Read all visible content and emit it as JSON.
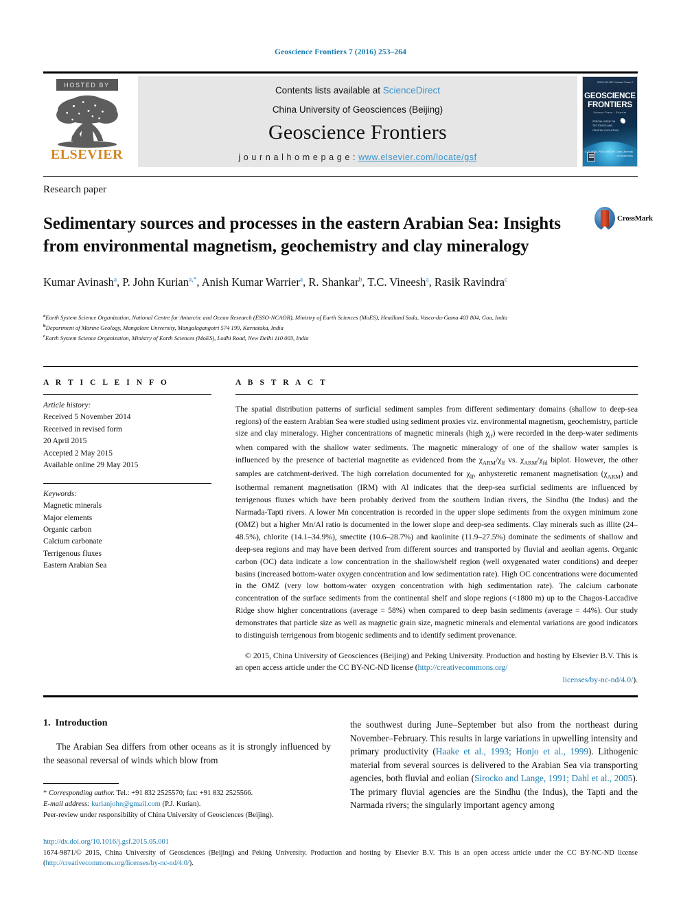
{
  "running_head": "Geoscience Frontiers 7 (2016) 253–264",
  "masthead": {
    "hosted_by": "HOSTED BY",
    "publisher_logo_word": "ELSEVIER",
    "contents_prefix": "Contents lists available at ",
    "contents_link": "ScienceDirect",
    "society_line": "China University of Geosciences (Beijing)",
    "journal_title": "Geoscience Frontiers",
    "homepage_label": "j o u r n a l   h o m e p a g e :  ",
    "homepage_url": "www.elsevier.com/locate/gsf",
    "cover": {
      "kicker": "ISSN 1674-9871\nVolume 7  Issue 2",
      "title_line1": "GEOSCIENCE",
      "title_line2": "FRONTIERS",
      "subtitle": "Science Press  ·  Elsevier",
      "mid_line1": "SPECIAL ISSUE ON",
      "mid_line2": "TECTONICS AND",
      "mid_line3": "CRUSTAL EVOLUTION",
      "bottom": "A JOURNAL PUBLISHED BY\nChina University of Geosciences"
    }
  },
  "article": {
    "kicker": "Research paper",
    "title": "Sedimentary sources and processes in the eastern Arabian Sea: Insights from environmental magnetism, geochemistry and clay mineralogy",
    "crossmark_label": "CrossMark",
    "authors": [
      {
        "name": "Kumar Avinash",
        "marks": "a"
      },
      {
        "name": "P. John Kurian",
        "marks": "a,*"
      },
      {
        "name": "Anish Kumar Warrier",
        "marks": "a"
      },
      {
        "name": "R. Shankar",
        "marks": "b"
      },
      {
        "name": "T.C. Vineesh",
        "marks": "a"
      },
      {
        "name": "Rasik Ravindra",
        "marks": "c"
      }
    ],
    "affiliations": [
      {
        "mark": "a",
        "text": "Earth System Science Organization, National Centre for Antarctic and Ocean Research (ESSO-NCAOR), Ministry of Earth Sciences (MoES), Headland Sada, Vasco-da-Gama 403 804, Goa, India"
      },
      {
        "mark": "b",
        "text": "Department of Marine Geology, Mangalore University, Mangalagangotri 574 199, Karnataka, India"
      },
      {
        "mark": "c",
        "text": "Earth System Science Organization, Ministry of Earth Sciences (MoES), Lodhi Road, New Delhi 110 003, India"
      }
    ]
  },
  "article_info": {
    "heading": "A R T I C L E  I N F O",
    "history_label": "Article history:",
    "history": [
      "Received 5 November 2014",
      "Received in revised form",
      "20 April 2015",
      "Accepted 2 May 2015",
      "Available online 29 May 2015"
    ],
    "keywords_label": "Keywords:",
    "keywords": [
      "Magnetic minerals",
      "Major elements",
      "Organic carbon",
      "Calcium carbonate",
      "Terrigenous fluxes",
      "Eastern Arabian Sea"
    ]
  },
  "abstract": {
    "heading": "A B S T R A C T",
    "body_part1": "The spatial distribution patterns of surficial sediment samples from different sedimentary domains (shallow to deep-sea regions) of the eastern Arabian Sea were studied using sediment proxies viz. environmental magnetism, geochemistry, particle size and clay mineralogy. Higher concentrations of magnetic minerals (high ",
    "chi_lf_1": "χ",
    "chi_lf_1_sub": "lf",
    "body_part2": ") were recorded in the deep-water sediments when compared with the shallow water sediments. The magnetic mineralogy of one of the shallow water samples is influenced by the presence of bacterial magnetite as evidenced from the ",
    "biplot_x1": "χ",
    "biplot_x1_sub": "ARM",
    "biplot_sep1": "/",
    "biplot_x2": "χ",
    "biplot_x2_sub": "lf",
    "biplot_vs": " vs. ",
    "biplot_x3": "χ",
    "biplot_x3_sub": "ARM",
    "biplot_sep2": "/",
    "biplot_x4": "χ",
    "biplot_x4_sub": "fd",
    "body_part3": " biplot. However, the other samples are catchment-derived. The high correlation documented for ",
    "chi_lf_2": "χ",
    "chi_lf_2_sub": "lf",
    "body_part4": ", anhysteretic remanent magnetisation (",
    "chi_arm": "χ",
    "chi_arm_sub": "ARM",
    "body_part5": ") and isothermal remanent magnetisation (IRM) with Al indicates that the deep-sea surficial sediments are influenced by terrigenous fluxes which have been probably derived from the southern Indian rivers, the Sindhu (the Indus) and the Narmada-Tapti rivers. A lower Mn concentration is recorded in the upper slope sediments from the oxygen minimum zone (OMZ) but a higher Mn/Al ratio is documented in the lower slope and deep-sea sediments. Clay minerals such as illite (24–48.5%), chlorite (14.1–34.9%), smectite (10.6–28.7%) and kaolinite (11.9–27.5%) dominate the sediments of shallow and deep-sea regions and may have been derived from different sources and transported by fluvial and aeolian agents. Organic carbon (OC) data indicate a low concentration in the shallow/shelf region (well oxygenated water conditions) and deeper basins (increased bottom-water oxygen concentration and low sedimentation rate). High OC concentrations were documented in the OMZ (very low bottom-water oxygen concentration with high sedimentation rate). The calcium carbonate concentration of the surface sediments from the continental shelf and slope regions (<1800 m) up to the Chagos-Laccadive Ridge show higher concentrations (average = 58%) when compared to deep basin sediments (average = 44%). Our study demonstrates that particle size as well as magnetic grain size, magnetic minerals and elemental variations are good indicators to distinguish terrigenous from biogenic sediments and to identify sediment provenance.",
    "copyright_text": "© 2015, China University of Geosciences (Beijing) and Peking University. Production and hosting by Elsevier B.V. This is an open access article under the CC BY-NC-ND license (",
    "copyright_link_1": "http://creativecommons.org/",
    "copyright_link_2": "licenses/by-nc-nd/4.0/",
    "copyright_tail": ")."
  },
  "introduction": {
    "heading_number": "1.",
    "heading_text": "Introduction",
    "paragraph_left": "The Arabian Sea differs from other oceans as it is strongly influenced by the seasonal reversal of winds which blow from",
    "paragraph_right_a": "the southwest during June–September but also from the northeast during November–February. This results in large variations in upwelling intensity and primary productivity (",
    "cite_1": "Haake et al., 1993; Honjo et al., 1999",
    "paragraph_right_b": "). Lithogenic material from several sources is delivered to the Arabian Sea via transporting agencies, both fluvial and eolian (",
    "cite_2": "Sirocko and Lange, 1991; Dahl et al., 2005",
    "paragraph_right_c": "). The primary fluvial agencies are the Sindhu (the Indus), the Tapti and the Narmada rivers; the singularly important agency among"
  },
  "footnotes": {
    "corresponding_mark": "*",
    "corresponding_label": "Corresponding author.",
    "corresponding_text": " Tel.: +91 832 2525570; fax: +91 832 2525566.",
    "email_label": "E-mail address:",
    "email": "kurianjohn@gmail.com",
    "email_owner": " (P.J. Kurian).",
    "peer_review": "Peer-review under responsibility of China University of Geosciences (Beijing)."
  },
  "page_footer": {
    "doi": "http://dx.doi.org/10.1016/j.gsf.2015.05.001",
    "issn_text": "1674-9871/© 2015, China University of Geosciences (Beijing) and Peking University. Production and hosting by Elsevier B.V. This is an open access article under the CC BY-NC-ND license (",
    "issn_link": "http://creativecommons.org/licenses/by-nc-nd/4.0/",
    "issn_tail": ")."
  },
  "colors": {
    "link_blue": "#1a7bb0",
    "sciencedirect_blue": "#3a91cc",
    "elsevier_orange": "#d4861f",
    "masthead_grey": "#e6e6e6"
  }
}
